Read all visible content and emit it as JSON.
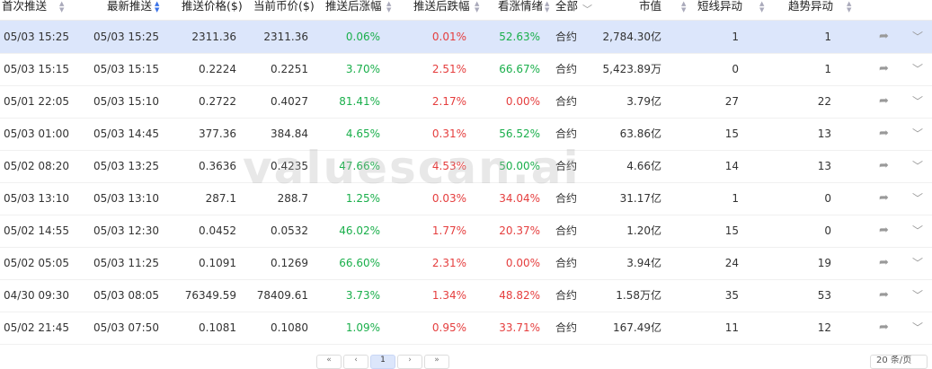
{
  "columns": {
    "first_push": "首次推送",
    "latest_push": "最新推送",
    "push_price": "推送价格($)",
    "current_price": "当前币价($)",
    "rise_after": "推送后涨幅",
    "fall_after": "推送后跌幅",
    "bullish": "看涨情绪",
    "filter_all": "全部",
    "market_cap": "市值",
    "short_move": "短线异动",
    "trend_move": "趋势异动"
  },
  "rows": [
    {
      "first": "05/03 15:25",
      "latest": "05/03 15:25",
      "push_price": "2311.36",
      "current": "2311.36",
      "rise": "0.06%",
      "fall": "0.01%",
      "bull": "52.63%",
      "bull_color": "green",
      "type": "合约",
      "cap": "2,784.30亿",
      "short": "1",
      "trend": "1"
    },
    {
      "first": "05/03 15:15",
      "latest": "05/03 15:15",
      "push_price": "0.2224",
      "current": "0.2251",
      "rise": "3.70%",
      "fall": "2.51%",
      "bull": "66.67%",
      "bull_color": "green",
      "type": "合约",
      "cap": "5,423.89万",
      "short": "0",
      "trend": "1"
    },
    {
      "first": "05/01 22:05",
      "latest": "05/03 15:10",
      "push_price": "0.2722",
      "current": "0.4027",
      "rise": "81.41%",
      "fall": "2.17%",
      "bull": "0.00%",
      "bull_color": "red",
      "type": "合约",
      "cap": "3.79亿",
      "short": "27",
      "trend": "22"
    },
    {
      "first": "05/03 01:00",
      "latest": "05/03 14:45",
      "push_price": "377.36",
      "current": "384.84",
      "rise": "4.65%",
      "fall": "0.31%",
      "bull": "56.52%",
      "bull_color": "green",
      "type": "合约",
      "cap": "63.86亿",
      "short": "15",
      "trend": "13"
    },
    {
      "first": "05/02 08:20",
      "latest": "05/03 13:25",
      "push_price": "0.3636",
      "current": "0.4235",
      "rise": "47.66%",
      "fall": "4.53%",
      "bull": "50.00%",
      "bull_color": "green",
      "type": "合约",
      "cap": "4.66亿",
      "short": "14",
      "trend": "13"
    },
    {
      "first": "05/03 13:10",
      "latest": "05/03 13:10",
      "push_price": "287.1",
      "current": "288.7",
      "rise": "1.25%",
      "fall": "0.03%",
      "bull": "34.04%",
      "bull_color": "red",
      "type": "合约",
      "cap": "31.17亿",
      "short": "1",
      "trend": "0"
    },
    {
      "first": "05/02 14:55",
      "latest": "05/03 12:30",
      "push_price": "0.0452",
      "current": "0.0532",
      "rise": "46.02%",
      "fall": "1.77%",
      "bull": "20.37%",
      "bull_color": "red",
      "type": "合约",
      "cap": "1.20亿",
      "short": "15",
      "trend": "0"
    },
    {
      "first": "05/02 05:05",
      "latest": "05/03 11:25",
      "push_price": "0.1091",
      "current": "0.1269",
      "rise": "66.60%",
      "fall": "2.31%",
      "bull": "0.00%",
      "bull_color": "red",
      "type": "合约",
      "cap": "3.94亿",
      "short": "24",
      "trend": "19"
    },
    {
      "first": "04/30 09:30",
      "latest": "05/03 08:05",
      "push_price": "76349.59",
      "current": "78409.61",
      "rise": "3.73%",
      "fall": "1.34%",
      "bull": "48.82%",
      "bull_color": "red",
      "type": "合约",
      "cap": "1.58万亿",
      "short": "35",
      "trend": "53"
    },
    {
      "first": "05/02 21:45",
      "latest": "05/03 07:50",
      "push_price": "0.1081",
      "current": "0.1080",
      "rise": "1.09%",
      "fall": "0.95%",
      "bull": "33.71%",
      "bull_color": "red",
      "type": "合约",
      "cap": "167.49亿",
      "short": "11",
      "trend": "12"
    }
  ],
  "watermark": "valuescan.ai",
  "pagination": {
    "first": "«",
    "prev": "‹",
    "current": "1",
    "next": "›",
    "last": "»",
    "page_size": "20 条/页"
  },
  "icons": {
    "share": "share-icon",
    "expand": "chevron-down-icon",
    "sort": "sort-icon",
    "filter": "filter-icon"
  },
  "colors": {
    "green": "#1aaf4b",
    "red": "#e53e3e",
    "highlight": "#dce6fb",
    "sort_active": "#3b73e8"
  }
}
